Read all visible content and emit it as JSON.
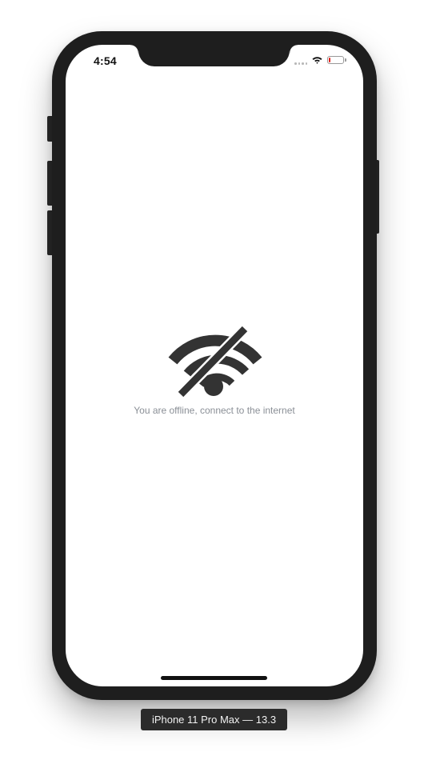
{
  "status_bar": {
    "time": "4:54",
    "signal_icon": "signal-dots-icon",
    "wifi_icon": "wifi-icon",
    "battery_icon": "battery-low-icon",
    "battery_level": 0.1,
    "battery_color": "#e0201b"
  },
  "content": {
    "icon": "wifi-off-icon",
    "icon_color": "#333333",
    "message": "You are offline, connect to the internet",
    "message_color": "#8a8f96"
  },
  "simulator": {
    "device_label": "iPhone 11 Pro Max — 13.3"
  }
}
